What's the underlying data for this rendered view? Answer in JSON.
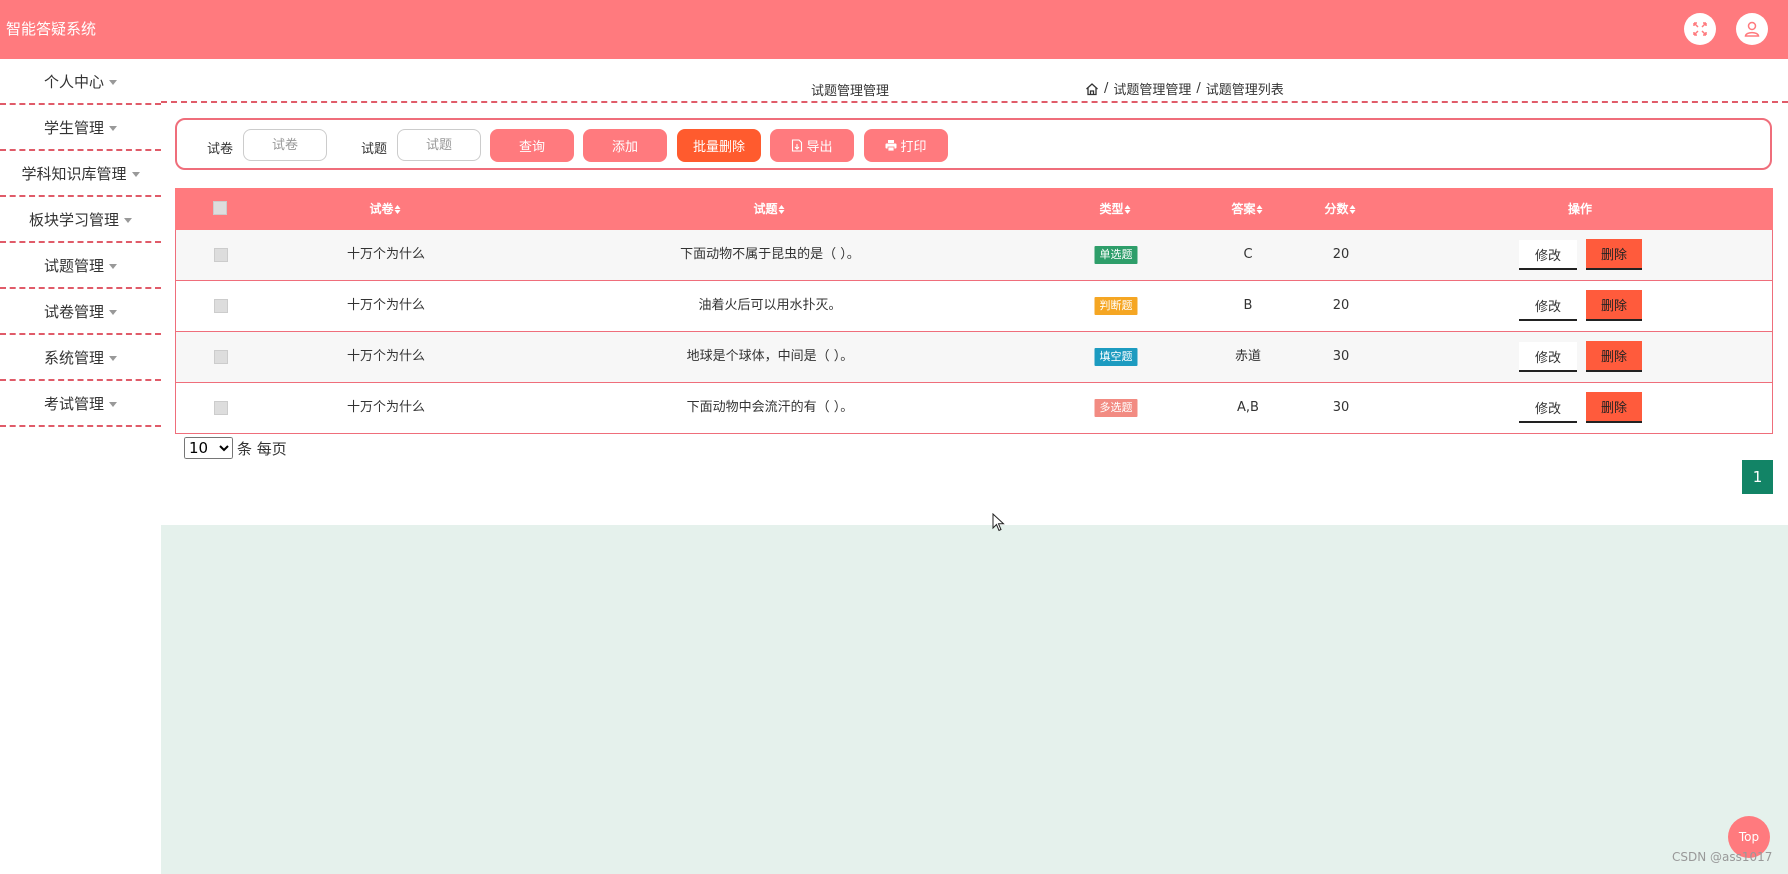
{
  "header": {
    "app_title": "智能答疑系统",
    "fullscreen_icon": "fullscreen-icon",
    "user_icon": "user-icon"
  },
  "sidebar": {
    "items": [
      {
        "label": "个人中心"
      },
      {
        "label": "学生管理"
      },
      {
        "label": "学科知识库管理"
      },
      {
        "label": "板块学习管理"
      },
      {
        "label": "试题管理"
      },
      {
        "label": "试卷管理"
      },
      {
        "label": "系统管理"
      },
      {
        "label": "考试管理"
      }
    ]
  },
  "breadcrumb": {
    "page_title": "试题管理管理",
    "home_icon": "home-icon",
    "separator": "/",
    "items": [
      "试题管理管理",
      "试题管理列表"
    ]
  },
  "search": {
    "paper_label": "试卷",
    "paper_placeholder": "试卷",
    "question_label": "试题",
    "question_placeholder": "试题",
    "query_button": "查询",
    "add_button": "添加",
    "batch_delete_button": "批量删除",
    "export_button": "导出",
    "print_button": "打印"
  },
  "table": {
    "columns": {
      "paper": "试卷",
      "question": "试题",
      "type": "类型",
      "answer": "答案",
      "score": "分数",
      "actions": "操作"
    },
    "rows": [
      {
        "paper": "十万个为什么",
        "question": "下面动物不属于昆虫的是（ ）。",
        "type": "单选题",
        "type_color": "#2e9e6a",
        "answer": "C",
        "score": "20",
        "edit": "修改",
        "delete": "删除"
      },
      {
        "paper": "十万个为什么",
        "question": "油着火后可以用水扑灭。",
        "type": "判断题",
        "type_color": "#f5a623",
        "answer": "B",
        "score": "20",
        "edit": "修改",
        "delete": "删除"
      },
      {
        "paper": "十万个为什么",
        "question": "地球是个球体，中间是（   ）。",
        "type": "填空题",
        "type_color": "#1c9bc0",
        "answer": "赤道",
        "score": "30",
        "edit": "修改",
        "delete": "删除"
      },
      {
        "paper": "十万个为什么",
        "question": "下面动物中会流汗的有（ ）。",
        "type": "多选题",
        "type_color": "#f28b82",
        "answer": "A,B",
        "score": "30",
        "edit": "修改",
        "delete": "删除"
      }
    ]
  },
  "pagination": {
    "page_size": "10",
    "page_size_suffix": "条 每页",
    "current_page": "1"
  },
  "footer": {
    "top_button": "Top",
    "watermark": "CSDN @ass1017"
  },
  "colors": {
    "primary": "#ff7a7e",
    "accent_dashed": "#e05b69",
    "danger": "#ff5b3c",
    "batch": "#ff5b2e",
    "pager_active": "#128466",
    "lower_bg": "#e5f1ec"
  }
}
